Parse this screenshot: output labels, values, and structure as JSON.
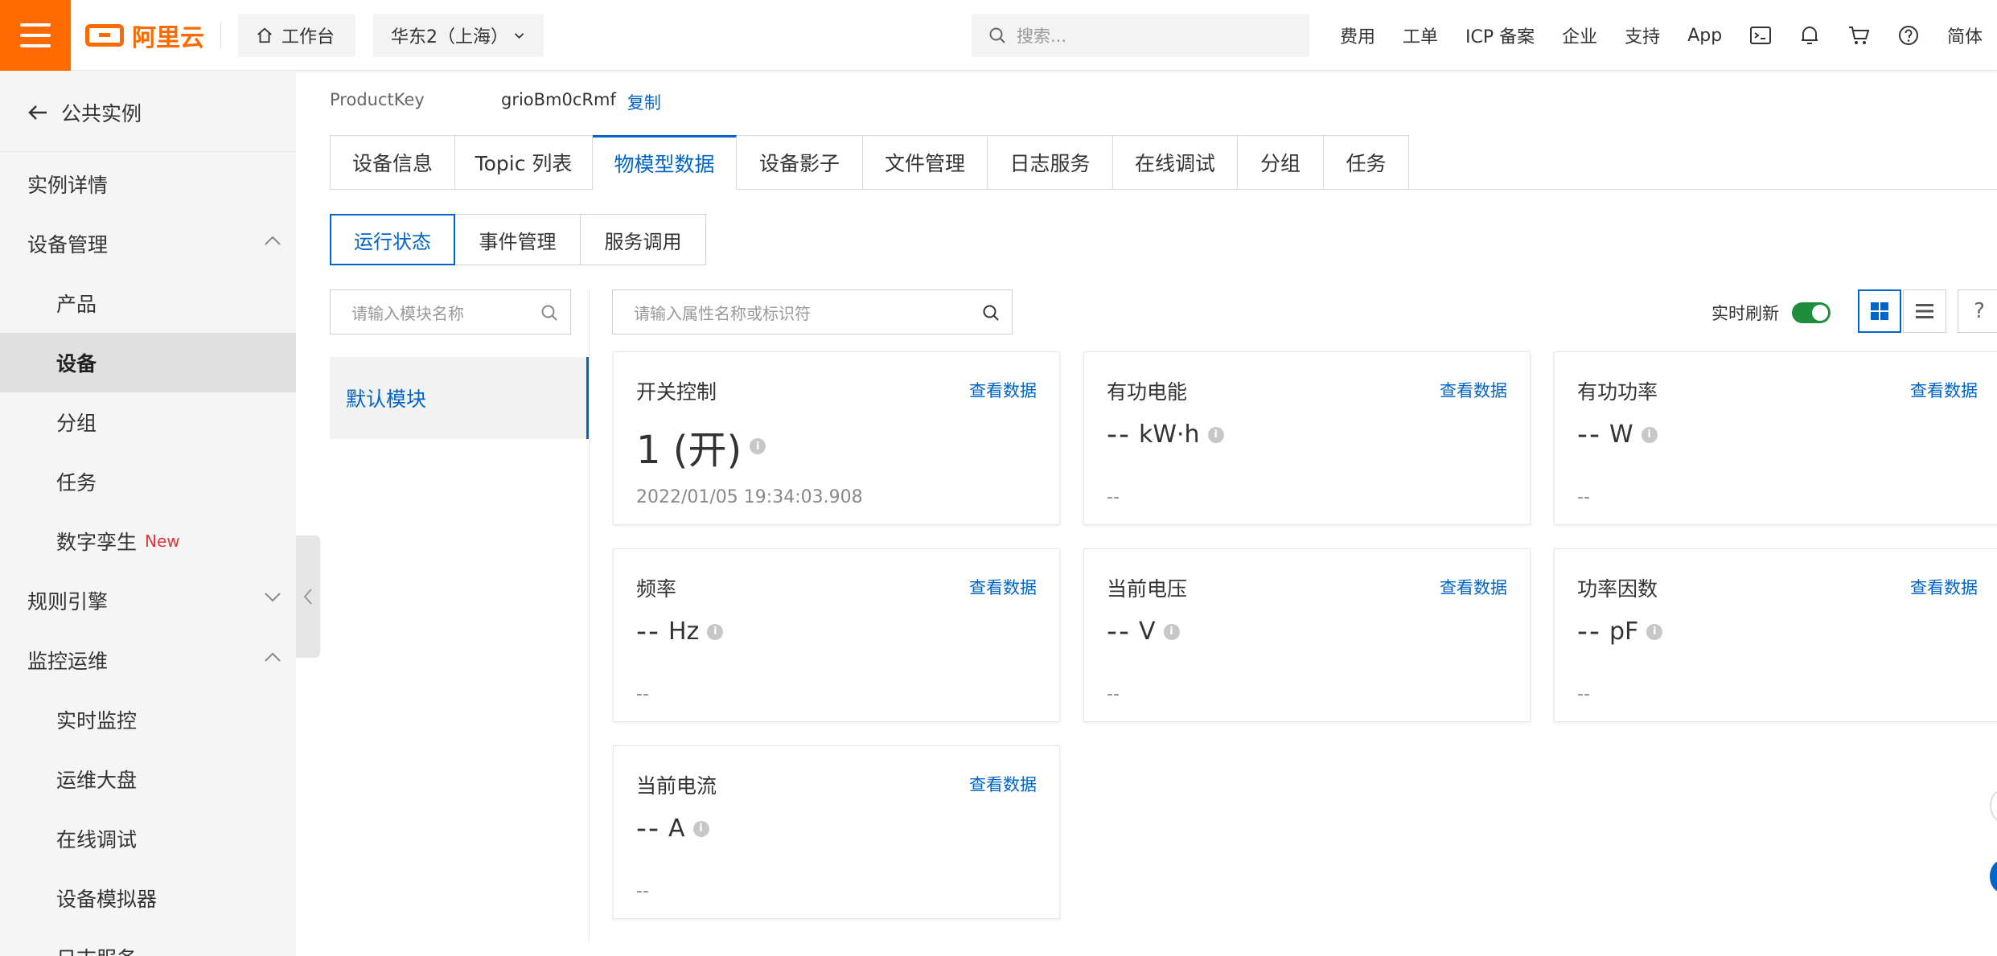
{
  "topbar": {
    "logo_text": "阿里云",
    "workbench": "工作台",
    "region": "华东2（上海）",
    "search_placeholder": "搜索...",
    "links": [
      "费用",
      "工单",
      "ICP 备案",
      "企业",
      "支持",
      "App"
    ],
    "lang": "简体",
    "icons": [
      "terminal-icon",
      "bell-icon",
      "cart-icon",
      "help-icon"
    ]
  },
  "sidebar": {
    "back_label": "公共实例",
    "items": [
      {
        "label": "实例详情",
        "level": 1
      },
      {
        "label": "设备管理",
        "level": 1,
        "expanded": true
      },
      {
        "label": "产品",
        "level": 2
      },
      {
        "label": "设备",
        "level": 2,
        "active": true
      },
      {
        "label": "分组",
        "level": 2
      },
      {
        "label": "任务",
        "level": 2
      },
      {
        "label": "数字孪生",
        "level": 2,
        "badge": "New"
      },
      {
        "label": "规则引擎",
        "level": 1,
        "expanded": false
      },
      {
        "label": "监控运维",
        "level": 1,
        "expanded": true
      },
      {
        "label": "实时监控",
        "level": 2
      },
      {
        "label": "运维大盘",
        "level": 2
      },
      {
        "label": "在线调试",
        "level": 2
      },
      {
        "label": "设备模拟器",
        "level": 2
      },
      {
        "label": "日志服务",
        "level": 2
      }
    ]
  },
  "product": {
    "key_label": "ProductKey",
    "key_value": "grioBm0cRmf",
    "copy_label": "复制"
  },
  "tabs": [
    {
      "label": "设备信息"
    },
    {
      "label": "Topic 列表"
    },
    {
      "label": "物模型数据",
      "active": true
    },
    {
      "label": "设备影子"
    },
    {
      "label": "文件管理"
    },
    {
      "label": "日志服务"
    },
    {
      "label": "在线调试"
    },
    {
      "label": "分组"
    },
    {
      "label": "任务"
    }
  ],
  "subtabs": [
    {
      "label": "运行状态",
      "active": true
    },
    {
      "label": "事件管理"
    },
    {
      "label": "服务调用"
    }
  ],
  "module_search_placeholder": "请输入模块名称",
  "property_search_placeholder": "请输入属性名称或标识符",
  "modules": [
    "默认模块"
  ],
  "realtime_refresh": {
    "label": "实时刷新",
    "enabled": true
  },
  "help_label": "?",
  "cards": [
    {
      "title": "开关控制",
      "link": "查看数据",
      "value": "1 (开)",
      "unit": "",
      "time": "2022/01/05 19:34:03.908"
    },
    {
      "title": "有功电能",
      "link": "查看数据",
      "value": "--",
      "unit": "kW·h",
      "time": "--"
    },
    {
      "title": "有功功率",
      "link": "查看数据",
      "value": "--",
      "unit": "W",
      "time": "--"
    },
    {
      "title": "频率",
      "link": "查看数据",
      "value": "--",
      "unit": "Hz",
      "time": "--"
    },
    {
      "title": "当前电压",
      "link": "查看数据",
      "value": "--",
      "unit": "V",
      "time": "--"
    },
    {
      "title": "功率因数",
      "link": "查看数据",
      "value": "--",
      "unit": "pF",
      "time": "--"
    },
    {
      "title": "当前电流",
      "link": "查看数据",
      "value": "--",
      "unit": "A",
      "time": "--"
    }
  ],
  "colors": {
    "brand": "#ff6a00",
    "link": "#0064c8",
    "toggle_on": "#1e8e3e",
    "badge_new": "#e6333a"
  }
}
